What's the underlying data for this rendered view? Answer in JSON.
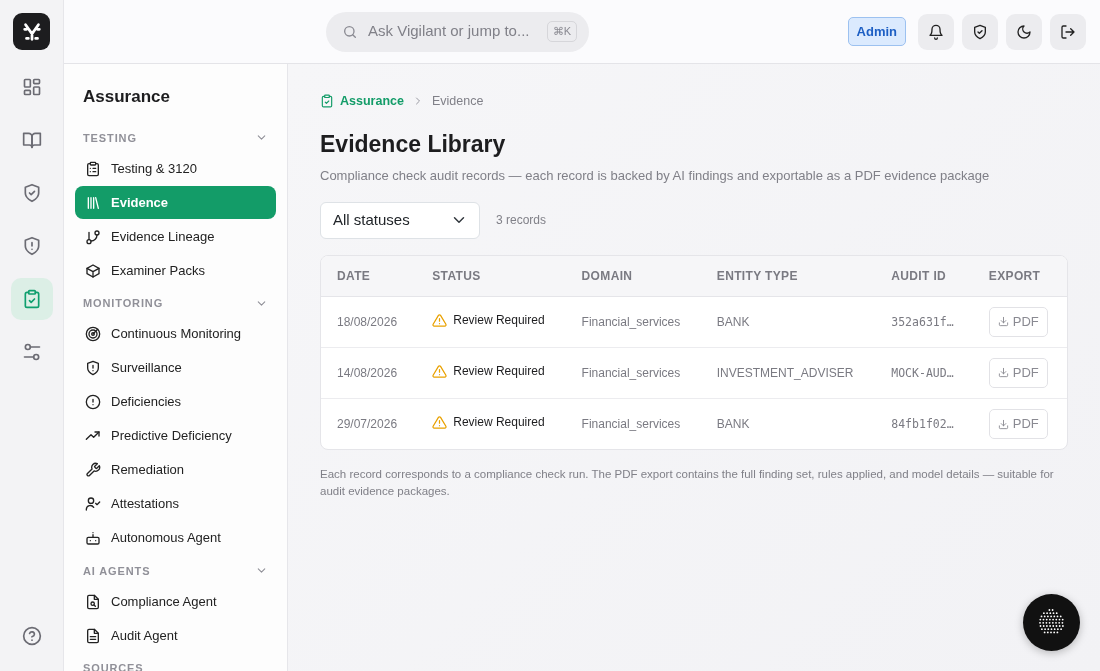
{
  "rail": {
    "items": [
      {
        "selected": false
      },
      {
        "selected": false
      },
      {
        "selected": false
      },
      {
        "selected": false
      },
      {
        "selected": true
      },
      {
        "selected": false
      }
    ]
  },
  "header": {
    "search": {
      "placeholder": "Ask Vigilant or jump to...",
      "shortcut": "⌘K"
    },
    "role_badge": "Admin"
  },
  "sidebar": {
    "title": "Assurance",
    "sections": [
      {
        "title": "TESTING",
        "expanded": true,
        "items": [
          {
            "label": "Testing & 3120",
            "selected": false
          },
          {
            "label": "Evidence",
            "selected": true
          },
          {
            "label": "Evidence Lineage",
            "selected": false
          },
          {
            "label": "Examiner Packs",
            "selected": false
          }
        ]
      },
      {
        "title": "MONITORING",
        "expanded": true,
        "items": [
          {
            "label": "Continuous Monitoring",
            "selected": false
          },
          {
            "label": "Surveillance",
            "selected": false
          },
          {
            "label": "Deficiencies",
            "selected": false
          },
          {
            "label": "Predictive Deficiency",
            "selected": false
          },
          {
            "label": "Remediation",
            "selected": false
          },
          {
            "label": "Attestations",
            "selected": false
          },
          {
            "label": "Autonomous Agent",
            "selected": false
          }
        ]
      },
      {
        "title": "AI AGENTS",
        "expanded": true,
        "items": [
          {
            "label": "Compliance Agent",
            "selected": false
          },
          {
            "label": "Audit Agent",
            "selected": false
          }
        ]
      },
      {
        "title": "SOURCES"
      }
    ]
  },
  "breadcrumb": [
    "Assurance",
    "Evidence"
  ],
  "page": {
    "title": "Evidence Library",
    "subtitle": "Compliance check audit records — each record is backed by AI findings and exportable as a PDF evidence package"
  },
  "filter": {
    "value": "All statuses",
    "count": "3 records"
  },
  "table": {
    "columns": [
      "DATE",
      "STATUS",
      "DOMAIN",
      "ENTITY TYPE",
      "AUDIT ID",
      "EXPORT"
    ],
    "rows": [
      {
        "date": "18/08/2026",
        "status": "Review Required",
        "domain": "Financial_services",
        "entity_type": "BANK",
        "audit_id": "352a631f…",
        "export": "PDF"
      },
      {
        "date": "14/08/2026",
        "status": "Review Required",
        "domain": "Financial_services",
        "entity_type": "INVESTMENT_ADVISER",
        "audit_id": "MOCK-AUD…",
        "export": "PDF"
      },
      {
        "date": "29/07/2026",
        "status": "Review Required",
        "domain": "Financial_services",
        "entity_type": "BANK",
        "audit_id": "84fb1f02…",
        "export": "PDF"
      }
    ]
  },
  "footnote": "Each record corresponds to a compliance check run. The PDF export contains the full finding set, rules applied, and model details — suitable for audit evidence packages."
}
